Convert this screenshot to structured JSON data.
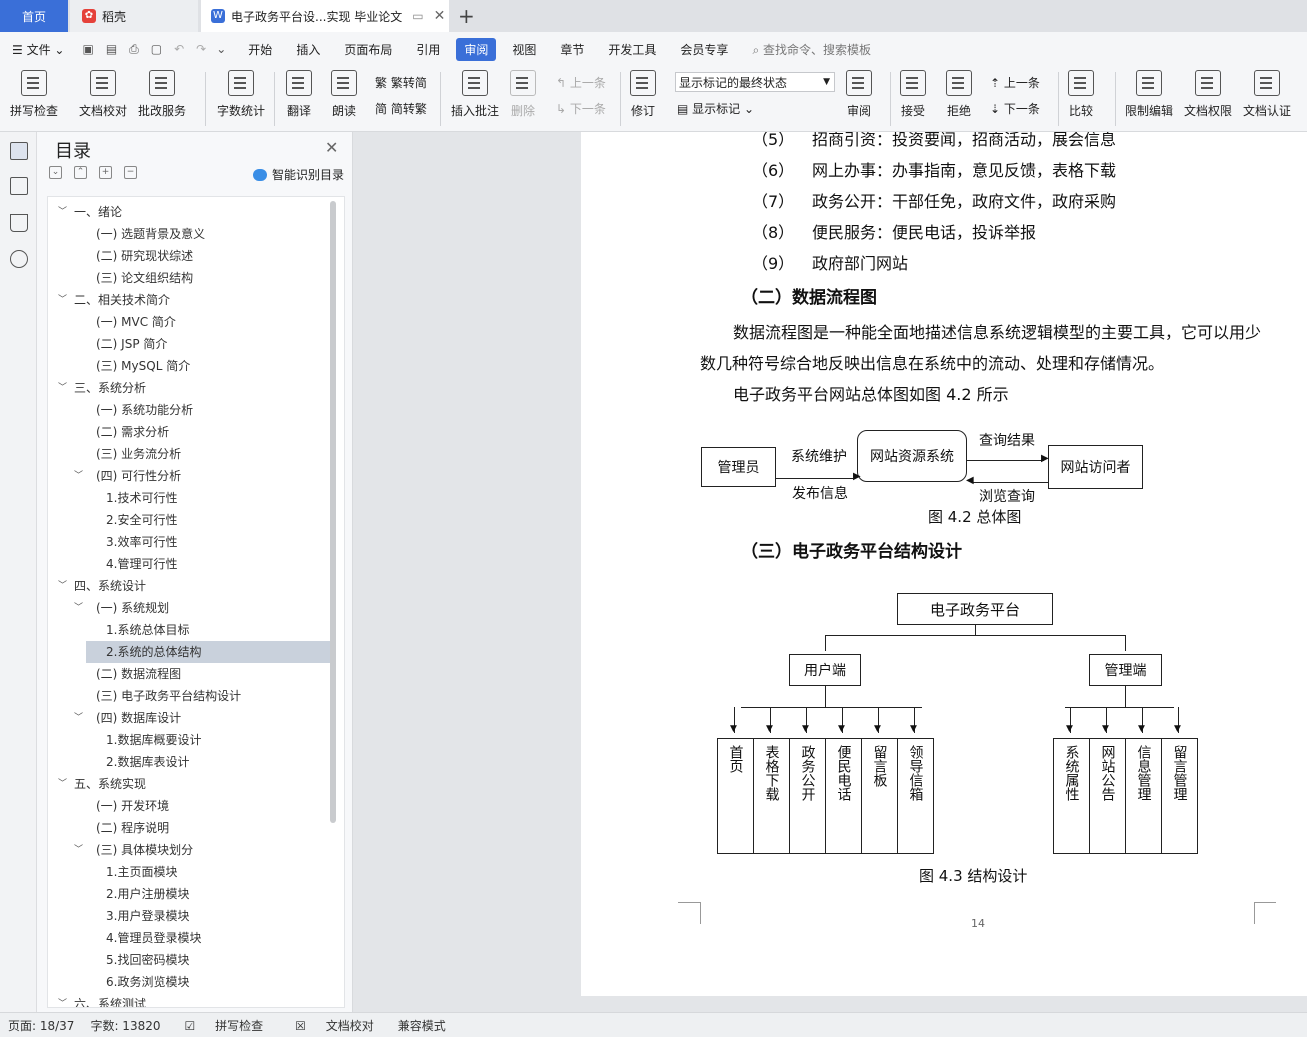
{
  "tabs": {
    "home": "首页",
    "daoke": "稻壳",
    "doc": "电子政务平台设...实现 毕业论文"
  },
  "menu": {
    "file": "文件",
    "items": [
      "开始",
      "插入",
      "页面布局",
      "引用",
      "审阅",
      "视图",
      "章节",
      "开发工具",
      "会员专享"
    ],
    "search": "查找命令、搜索模板"
  },
  "ribbon": {
    "spell": "拼写检查",
    "proof": "文档校对",
    "batch": "批改服务",
    "wordcount": "字数统计",
    "translate": "翻译",
    "read": "朗读",
    "to_trad": "繁转简",
    "to_simp": "简转繁",
    "add_comment": "插入批注",
    "delete": "删除",
    "prev": "上一条",
    "next": "下一条",
    "track": "修订",
    "markup_state": "显示标记的最终状态",
    "show_markup": "显示标记",
    "review": "审阅",
    "accept": "接受",
    "reject": "拒绝",
    "prev2": "上一条",
    "next2": "下一条",
    "compare": "比较",
    "restrict": "限制编辑",
    "rights": "文档权限",
    "cert": "文档认证"
  },
  "toc": {
    "title": "目录",
    "smart": "智能识别目录",
    "items": [
      {
        "t": "一、绪论",
        "lv": 0,
        "arrow": "v"
      },
      {
        "t": "(一) 选题背景及意义",
        "lv": 1
      },
      {
        "t": "(二) 研究现状综述",
        "lv": 1
      },
      {
        "t": "(三) 论文组织结构",
        "lv": 1
      },
      {
        "t": "二、相关技术简介",
        "lv": 0,
        "arrow": "v"
      },
      {
        "t": "(一) MVC 简介",
        "lv": 1
      },
      {
        "t": "(二) JSP 简介",
        "lv": 1
      },
      {
        "t": "(三) MySQL 简介",
        "lv": 1
      },
      {
        "t": "三、系统分析",
        "lv": 0,
        "arrow": "v"
      },
      {
        "t": "(一) 系统功能分析",
        "lv": 1
      },
      {
        "t": "(二) 需求分析",
        "lv": 1
      },
      {
        "t": "(三) 业务流分析",
        "lv": 1
      },
      {
        "t": "(四) 可行性分析",
        "lv": 1,
        "arrow": "v"
      },
      {
        "t": "1.技术可行性",
        "lv": 2
      },
      {
        "t": "2.安全可行性",
        "lv": 2
      },
      {
        "t": "3.效率可行性",
        "lv": 2
      },
      {
        "t": "4.管理可行性",
        "lv": 2
      },
      {
        "t": "四、系统设计",
        "lv": 0,
        "arrow": "v"
      },
      {
        "t": "(一) 系统规划",
        "lv": 1,
        "arrow": "v"
      },
      {
        "t": "1.系统总体目标",
        "lv": 2
      },
      {
        "t": "2.系统的总体结构",
        "lv": 2,
        "sel": true
      },
      {
        "t": "(二) 数据流程图",
        "lv": 1
      },
      {
        "t": "(三) 电子政务平台结构设计",
        "lv": 1
      },
      {
        "t": "(四) 数据库设计",
        "lv": 1,
        "arrow": "v"
      },
      {
        "t": "1.数据库概要设计",
        "lv": 2
      },
      {
        "t": "2.数据库表设计",
        "lv": 2
      },
      {
        "t": "五、系统实现",
        "lv": 0,
        "arrow": "v"
      },
      {
        "t": "(一) 开发环境",
        "lv": 1
      },
      {
        "t": "(二) 程序说明",
        "lv": 1
      },
      {
        "t": "(三) 具体模块划分",
        "lv": 1,
        "arrow": "v"
      },
      {
        "t": "1.主页面模块",
        "lv": 2
      },
      {
        "t": "2.用户注册模块",
        "lv": 2
      },
      {
        "t": "3.用户登录模块",
        "lv": 2
      },
      {
        "t": "4.管理员登录模块",
        "lv": 2
      },
      {
        "t": "5.找回密码模块",
        "lv": 2
      },
      {
        "t": "6.政务浏览模块",
        "lv": 2
      },
      {
        "t": "六、系统测试",
        "lv": 0,
        "arrow": "v"
      }
    ]
  },
  "doc": {
    "list": [
      {
        "n": "（5）",
        "t": "招商引资：投资要闻，招商活动，展会信息"
      },
      {
        "n": "（6）",
        "t": "网上办事：办事指南，意见反馈，表格下载"
      },
      {
        "n": "（7）",
        "t": "政务公开：干部任免，政府文件，政府采购"
      },
      {
        "n": "（8）",
        "t": "便民服务：便民电话，投诉举报"
      },
      {
        "n": "（9）",
        "t": "政府部门网站"
      }
    ],
    "h2": "（二）数据流程图",
    "p1a": "数据流程图是一种能全面地描述信息系统逻辑模型的主要工具，它可以用少",
    "p1b": "数几种符号综合地反映出信息在系统中的流动、处理和存储情况。",
    "p2": "电子政务平台网站总体图如图 4.2 所示",
    "fig1": {
      "admin": "管理员",
      "system": "网站资源系统",
      "visitor": "网站访问者",
      "maint": "系统维护",
      "publish": "发布信息",
      "result": "查询结果",
      "browse": "浏览查询",
      "caption": "图 4.2 总体图"
    },
    "h3": "（三）电子政务平台结构设计",
    "fig2": {
      "root": "电子政务平台",
      "user": "用户端",
      "admin": "管理端",
      "user_leaves": [
        "首页",
        "表格下载",
        "政务公开",
        "便民电话",
        "留言板",
        "领导信箱"
      ],
      "admin_leaves": [
        "系统属性",
        "网站公告",
        "信息管理",
        "留言管理"
      ],
      "caption": "图 4.3 结构设计"
    },
    "page_no": "14"
  },
  "status": {
    "page": "页面: 18/37",
    "words": "字数: 13820",
    "spell": "拼写检查",
    "proof": "文档校对",
    "compat": "兼容模式"
  }
}
